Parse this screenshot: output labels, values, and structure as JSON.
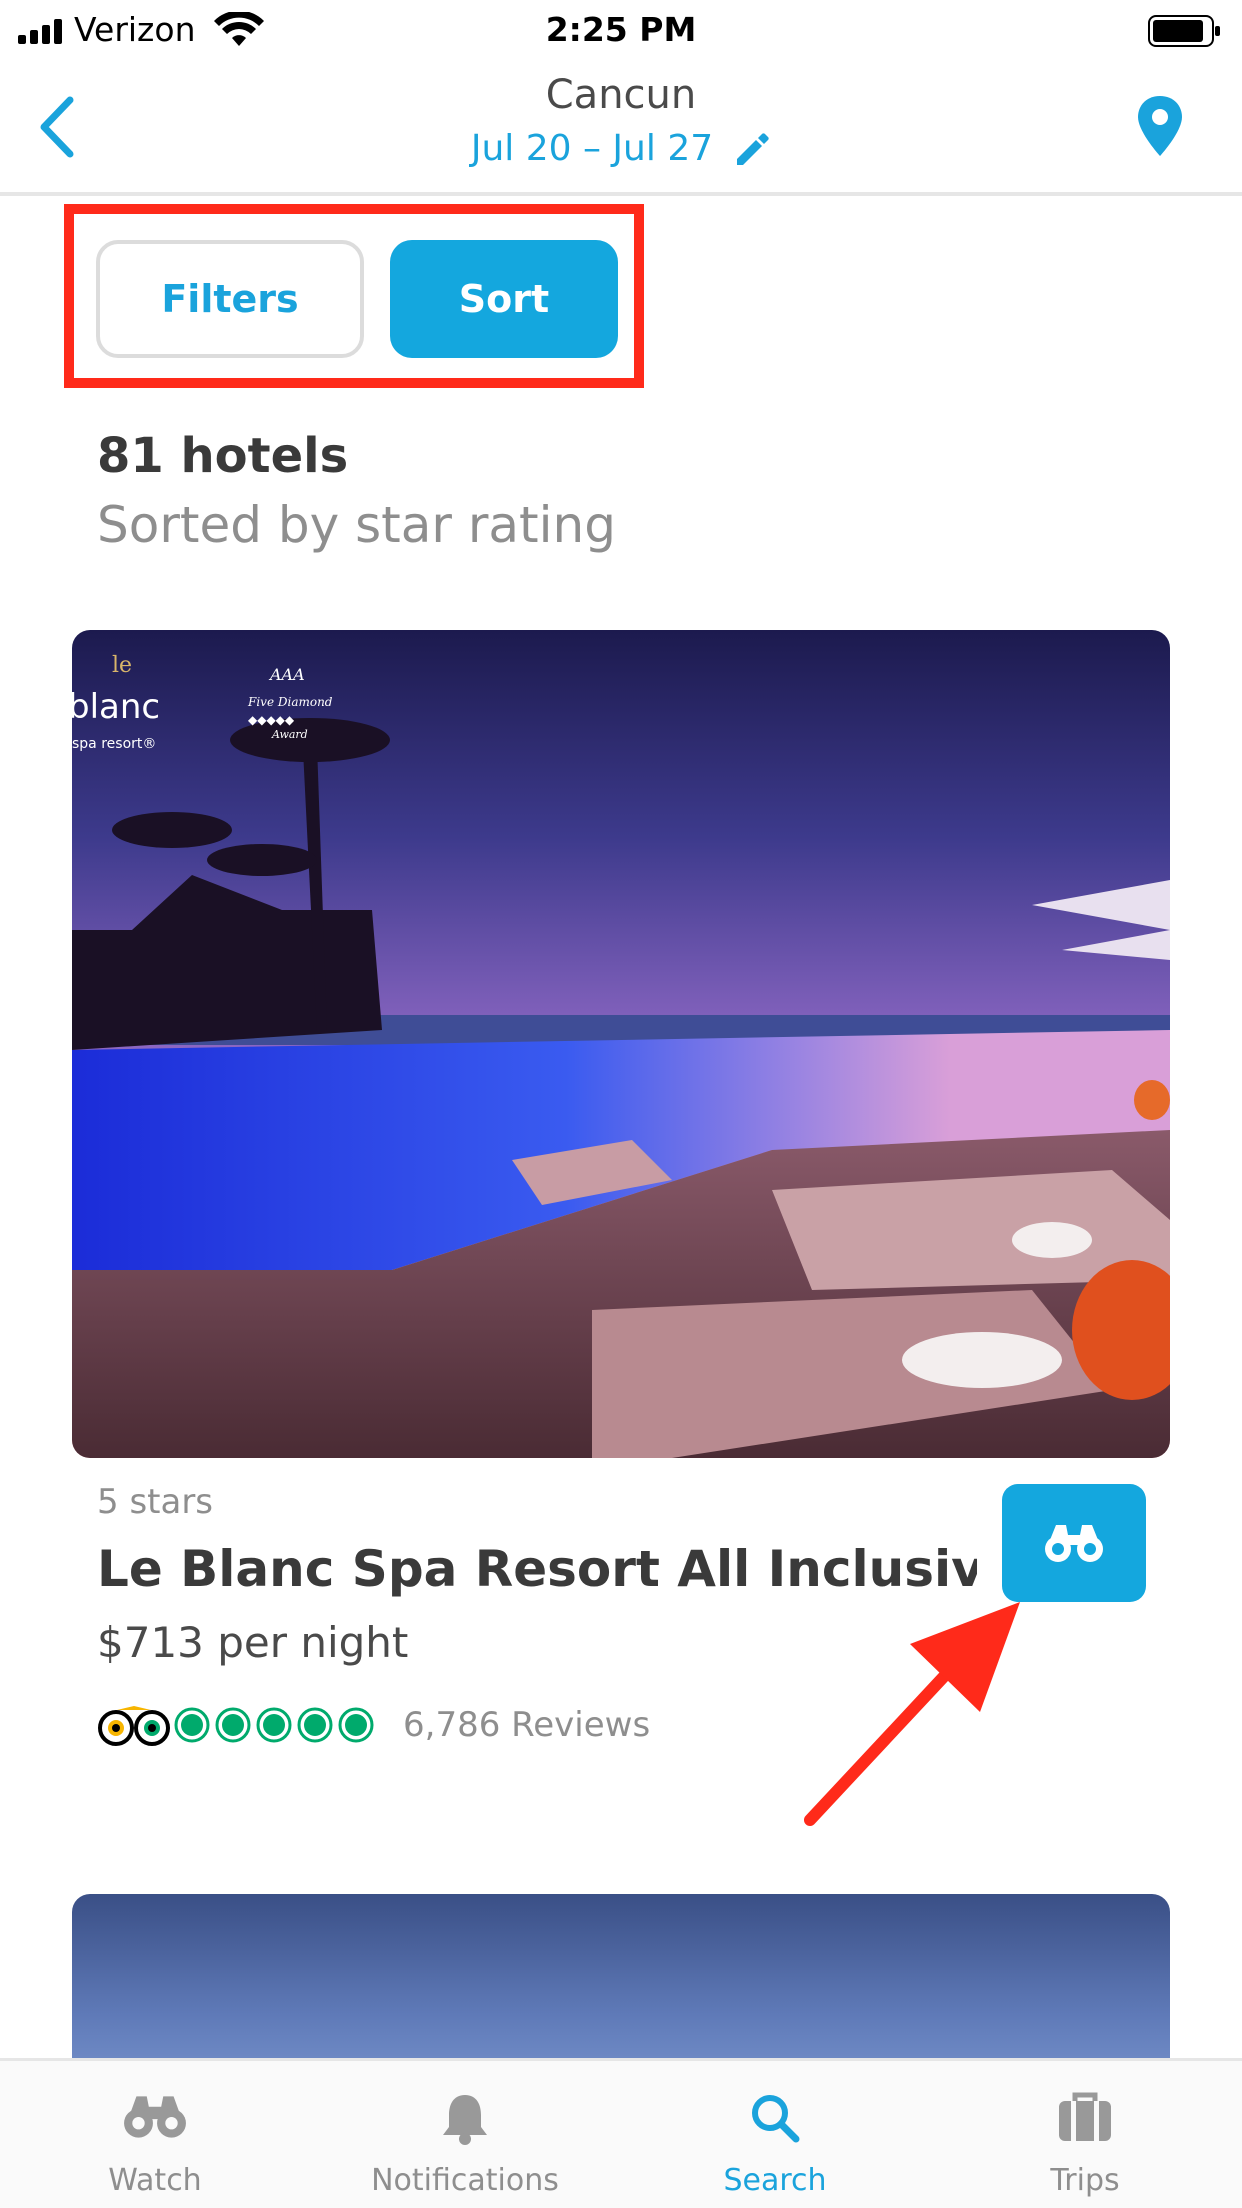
{
  "status_bar": {
    "carrier": "Verizon",
    "time": "2:25 PM"
  },
  "header": {
    "title": "Cancun",
    "dates": "Jul 20 – Jul 27",
    "back_icon": "chevron-left-icon",
    "edit_icon": "pencil-icon",
    "location_icon": "map-pin-icon"
  },
  "toolbar": {
    "filters_label": "Filters",
    "sort_label": "Sort"
  },
  "results": {
    "count_label": "81 hotels",
    "sort_description": "Sorted by star rating"
  },
  "hotels": [
    {
      "stars_label": "5 stars",
      "name": "Le Blanc Spa Resort All Inclusive...",
      "price": "$713 per night",
      "rating_circles": 5,
      "reviews": "6,786 Reviews",
      "photo_overlay": {
        "brand": "blanc",
        "brand_sub": "spa resort®",
        "award": "Five Diamond Award",
        "award_badge": "AAA"
      }
    }
  ],
  "tabs": [
    {
      "label": "Watch",
      "icon": "binoculars-icon",
      "active": false
    },
    {
      "label": "Notifications",
      "icon": "bell-icon",
      "active": false
    },
    {
      "label": "Search",
      "icon": "search-icon",
      "active": true
    },
    {
      "label": "Trips",
      "icon": "suitcase-icon",
      "active": false
    }
  ],
  "colors": {
    "accent": "#1aa3dc",
    "highlight": "#ff2a1a",
    "tripadvisor_green": "#00aa6c"
  }
}
